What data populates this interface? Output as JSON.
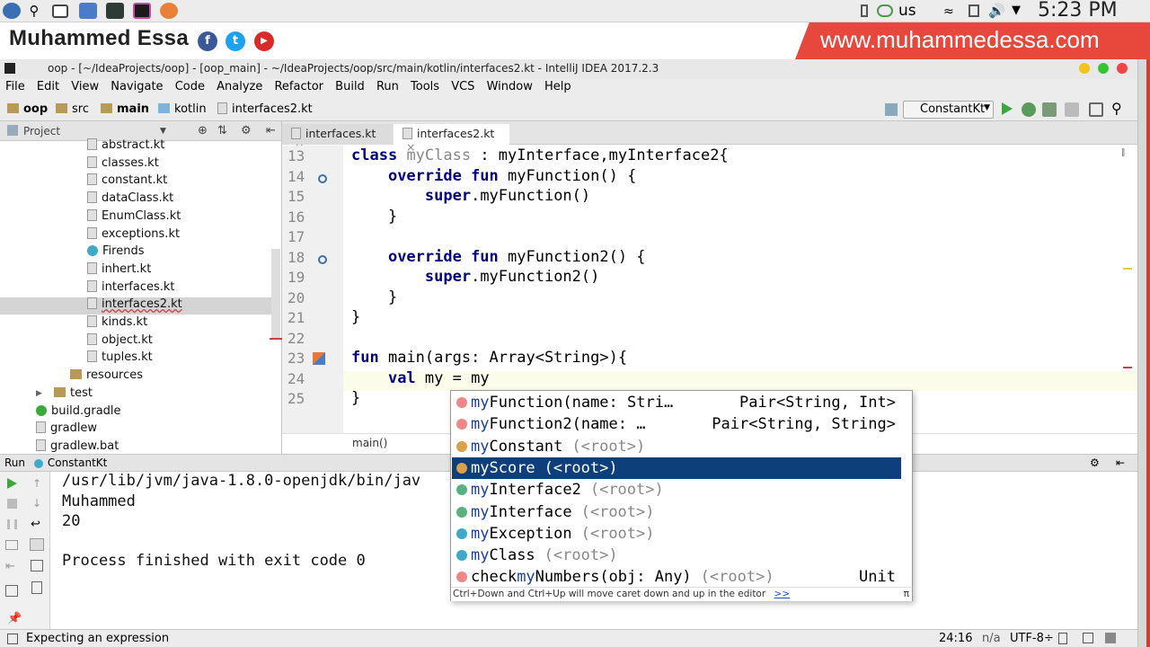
{
  "topbar": {
    "clock": "5:23 PM",
    "lang": "us",
    "launcher_icons": [
      "fedora-icon",
      "search-icon",
      "desktop-icon",
      "files-icon",
      "terminal-icon",
      "intellij-icon",
      "firefox-icon"
    ]
  },
  "banner": {
    "name": "Muhammed Essa",
    "site": "www.muhammedessa.com",
    "social_fb": "f",
    "social_tw": "t",
    "social_yt": "▶"
  },
  "window": {
    "title": "oop - [~/IdeaProjects/oop] - [oop_main] - ~/IdeaProjects/oop/src/main/kotlin/interfaces2.kt - IntelliJ IDEA 2017.2.3"
  },
  "menu": [
    "File",
    "Edit",
    "View",
    "Navigate",
    "Code",
    "Analyze",
    "Refactor",
    "Build",
    "Run",
    "Tools",
    "VCS",
    "Window",
    "Help"
  ],
  "nav": {
    "crumbs": [
      "oop",
      "src",
      "main",
      "kotlin",
      "interfaces2.kt"
    ],
    "run_config": "ConstantKt"
  },
  "project": {
    "header": "Project",
    "items": [
      {
        "label": "abstract.kt",
        "type": "file",
        "indent": 97
      },
      {
        "label": "classes.kt",
        "type": "file",
        "indent": 97
      },
      {
        "label": "constant.kt",
        "type": "file",
        "indent": 97
      },
      {
        "label": "dataClass.kt",
        "type": "file",
        "indent": 97
      },
      {
        "label": "EnumClass.kt",
        "type": "file",
        "indent": 97
      },
      {
        "label": "exceptions.kt",
        "type": "file",
        "indent": 97
      },
      {
        "label": "Firends",
        "type": "class",
        "indent": 97
      },
      {
        "label": "inhert.kt",
        "type": "file",
        "indent": 97
      },
      {
        "label": "interfaces.kt",
        "type": "file",
        "indent": 97
      },
      {
        "label": "interfaces2.kt",
        "type": "file",
        "indent": 97,
        "selected": true
      },
      {
        "label": "kinds.kt",
        "type": "file",
        "indent": 97
      },
      {
        "label": "object.kt",
        "type": "file",
        "indent": 97
      },
      {
        "label": "tuples.kt",
        "type": "file",
        "indent": 97
      },
      {
        "label": "resources",
        "type": "dir",
        "indent": 78
      },
      {
        "label": "test",
        "type": "dir",
        "indent": 60,
        "arrow": "▶"
      },
      {
        "label": "build.gradle",
        "type": "gradle",
        "indent": 40
      },
      {
        "label": "gradlew",
        "type": "file",
        "indent": 40
      },
      {
        "label": "gradlew.bat",
        "type": "file",
        "indent": 40
      }
    ]
  },
  "tabs": [
    {
      "label": "interfaces.kt",
      "close": "×"
    },
    {
      "label": "interfaces2.kt",
      "close": "×",
      "active": true
    }
  ],
  "code": {
    "lines": [
      {
        "n": "13",
        "html": "<span class=\"kw\">class</span> <span class=\"gr\">myClass</span> : myInterface,myInterface2{"
      },
      {
        "n": "14",
        "html": "    <span class=\"kw\">override fun</span> myFunction() {"
      },
      {
        "n": "15",
        "html": "        <span class=\"kw\">super</span>.myFunction()"
      },
      {
        "n": "16",
        "html": "    }"
      },
      {
        "n": "17",
        "html": ""
      },
      {
        "n": "18",
        "html": "    <span class=\"kw\">override fun</span> myFunction2() {"
      },
      {
        "n": "19",
        "html": "        <span class=\"kw\">super</span>.myFunction2()"
      },
      {
        "n": "20",
        "html": "    }"
      },
      {
        "n": "21",
        "html": "}"
      },
      {
        "n": "22",
        "html": ""
      },
      {
        "n": "23",
        "html": "<span class=\"kw\">fun</span> main(args: Array&lt;String&gt;){"
      },
      {
        "n": "24",
        "html": "    <span class=\"kw\">val</span> my = my"
      },
      {
        "n": "25",
        "html": "}"
      }
    ],
    "breadcrumb": "main()"
  },
  "completion": {
    "items": [
      {
        "prefix": "my",
        "rest": "Function(name: Stri…",
        "type": "Pair<String, Int>",
        "icon": "#e88",
        "kind": "function-icon"
      },
      {
        "prefix": "my",
        "rest": "Function2(name: …",
        "type": "Pair<String, String>",
        "icon": "#e88",
        "kind": "function-icon"
      },
      {
        "prefix": "my",
        "rest": "Constant",
        "loc": "(<root>)",
        "type": "",
        "icon": "#d9a14a",
        "kind": "property-icon"
      },
      {
        "prefix": "my",
        "rest": "Score",
        "loc": "(<root>)",
        "type": "",
        "icon": "#d9a14a",
        "kind": "property-icon",
        "selected": true
      },
      {
        "prefix": "my",
        "rest": "Interface2",
        "loc": "(<root>)",
        "type": "",
        "icon": "#5bb082",
        "kind": "interface-icon"
      },
      {
        "prefix": "my",
        "rest": "Interface",
        "loc": "(<root>)",
        "type": "",
        "icon": "#5bb082",
        "kind": "interface-icon"
      },
      {
        "prefix": "my",
        "rest": "Exception",
        "loc": "(<root>)",
        "type": "",
        "icon": "#41a9c8",
        "kind": "class-icon"
      },
      {
        "prefix": "my",
        "rest": "Class",
        "loc": "(<root>)",
        "type": "",
        "icon": "#41a9c8",
        "kind": "class-icon"
      },
      {
        "prefix": "check",
        "mid": "my",
        "rest": "Numbers(obj: Any)",
        "loc": "(<root>)",
        "type": "Unit",
        "icon": "#e88",
        "kind": "function-icon"
      }
    ],
    "hint": "Ctrl+Down and Ctrl+Up will move caret down and up in the editor",
    "hint_link": ">>",
    "pi": "π"
  },
  "run": {
    "label": "Run",
    "config": "ConstantKt",
    "output": [
      "/usr/lib/jvm/java-1.8.0-openjdk/bin/jav",
      "Muhammed",
      "20",
      "",
      "Process finished with exit code 0"
    ]
  },
  "status": {
    "message": "Expecting an expression",
    "position": "24:16",
    "na": "n/a",
    "encoding": "UTF-8÷"
  }
}
